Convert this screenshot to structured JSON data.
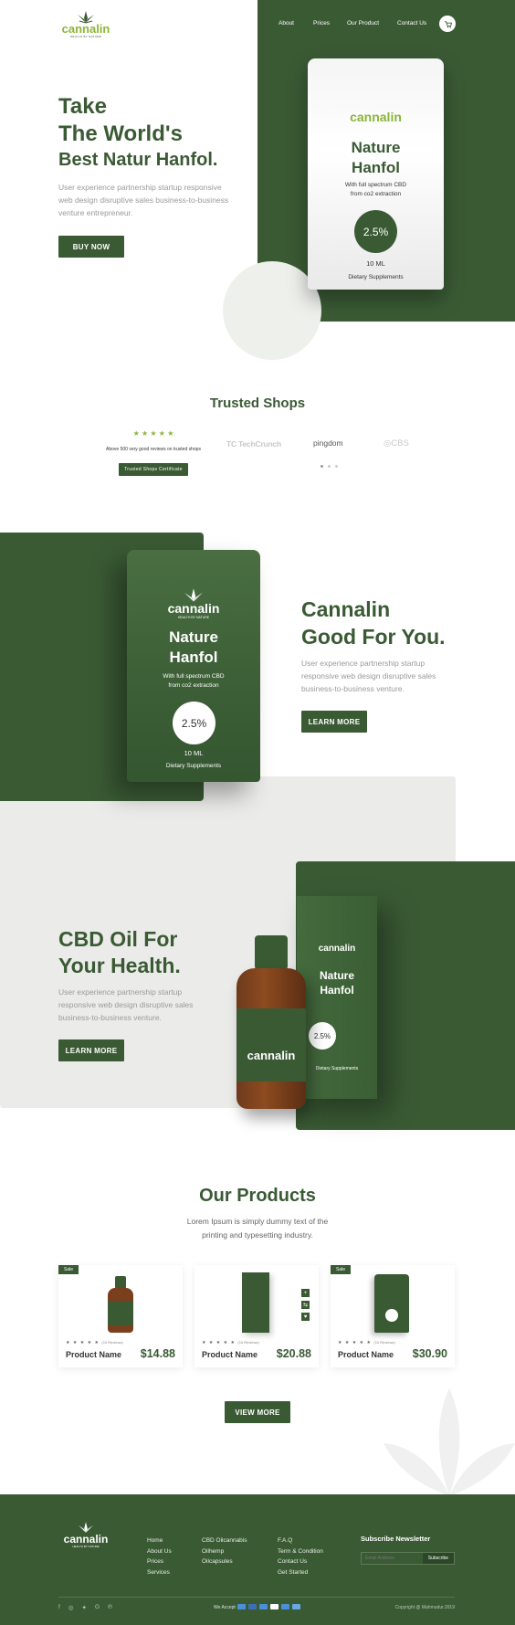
{
  "brand": {
    "name": "cannalin",
    "tagline": "HEALTH BY NATURE"
  },
  "nav": {
    "items": [
      {
        "label": "About"
      },
      {
        "label": "Prices"
      },
      {
        "label": "Our Product"
      },
      {
        "label": "Contact Us"
      }
    ]
  },
  "hero": {
    "line1": "Take",
    "line2": "The World's",
    "line3": "Best Natur Hanfol.",
    "body": "User experience partnership startup responsive web design disruptive sales business-to-business venture entrepreneur.",
    "cta": "BUY NOW"
  },
  "pouch": {
    "brand": "cannalin",
    "tagline": "HEALTH BY NATURE",
    "title1": "Nature",
    "title2": "Hanfol",
    "line1": "With full spectrum CBD",
    "line2": "from co2 extraction",
    "percent": "2.5%",
    "volume": "10 ML",
    "footer": "Dietary Supplements"
  },
  "trusted": {
    "heading": "Trusted Shops",
    "stars": "★ ★ ★ ★ ★",
    "note": "Above 500 very good reviews on trusted shops",
    "button": "Trusted Shops Certificate",
    "logos": [
      {
        "label": "TechCrunch"
      },
      {
        "label": "pingdom"
      },
      {
        "label": "CBS"
      }
    ]
  },
  "good": {
    "line1": "Cannalin",
    "line2": "Good For You.",
    "body": "User experience partnership startup responsive web design disruptive sales business-to-business venture.",
    "cta": "LEARN MORE"
  },
  "oil": {
    "line1": "CBD Oil For",
    "line2": "Your Health.",
    "body": "User experience partnership startup responsive web design disruptive sales business-to-business venture.",
    "cta": "LEARN MORE"
  },
  "products": {
    "heading": "Our Products",
    "sub1": "Lorem Ipsum is simply dummy text of the",
    "sub2": "printing and typesetting  industry.",
    "sale": "Sale",
    "stars": "★ ★ ★ ★ ★",
    "reviews": "(10 Reviews)",
    "items": [
      {
        "name": "Product Name",
        "price": "$14.88"
      },
      {
        "name": "Product Name",
        "price": "$20.88"
      },
      {
        "name": "Product Name",
        "price": "$30.90"
      }
    ],
    "view_more": "VIEW MORE"
  },
  "footer": {
    "col1": [
      "Home",
      "About Us",
      "Prices",
      "Services"
    ],
    "col2": [
      "CBD Oilcannabis",
      "Oilhemp",
      "Oilcapsules"
    ],
    "col3": [
      "F.A.Q",
      "Term & Condition",
      "Contact Us",
      "Get Started"
    ],
    "newsletter": {
      "title": "Subscribe Newsletter",
      "placeholder": "Email Address",
      "button": "Subscribe"
    },
    "we_accept": "We Accept",
    "copyright": "Copyright @ Mahmudur.2019"
  },
  "colors": {
    "primary": "#3a5a34",
    "light_bg": "#ebecea",
    "accent_star": "#8bb53a"
  }
}
